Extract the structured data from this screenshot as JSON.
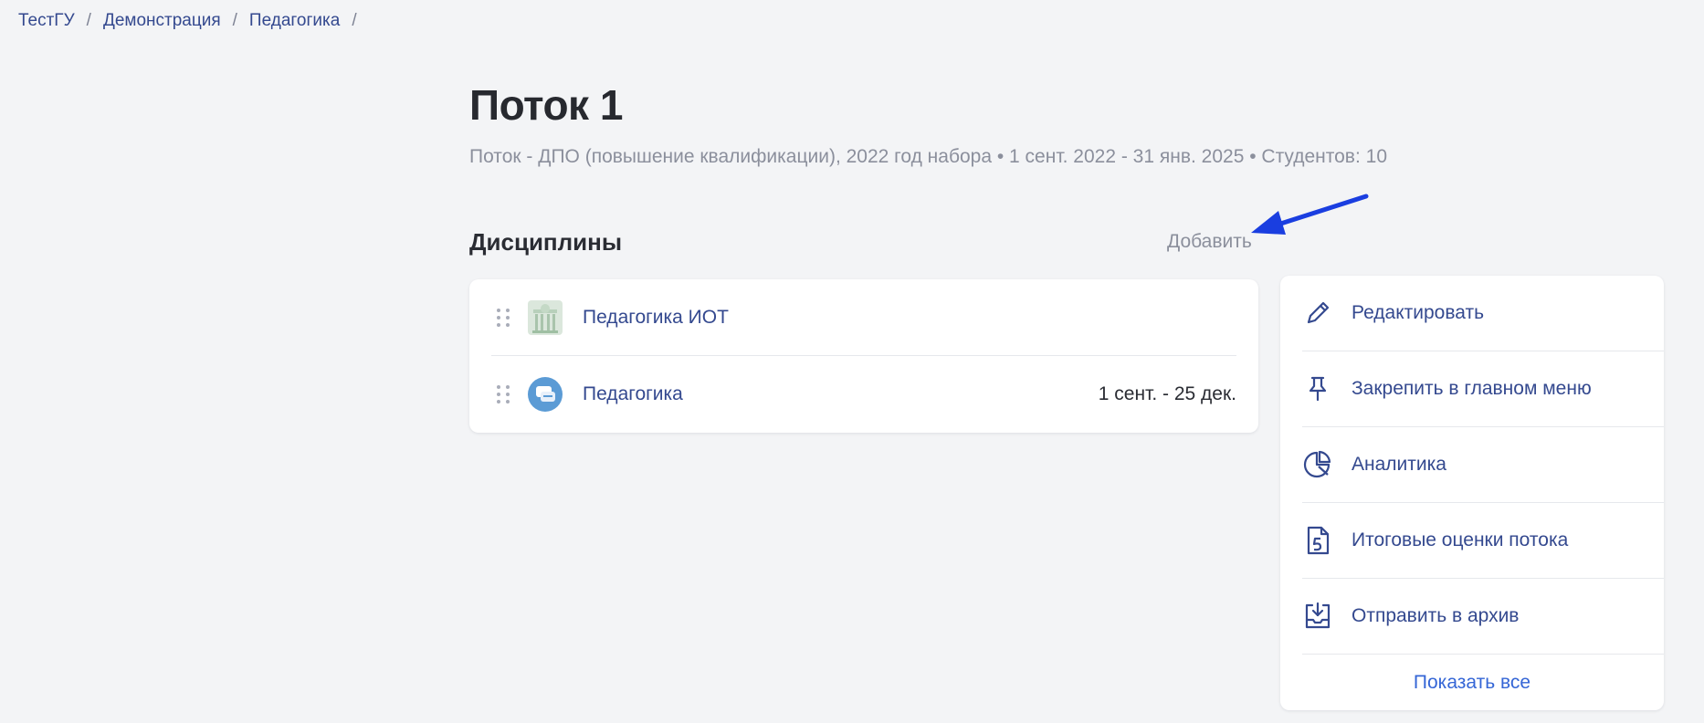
{
  "breadcrumb": {
    "items": [
      "ТестГУ",
      "Демонстрация",
      "Педагогика"
    ],
    "separator": "/"
  },
  "header": {
    "title": "Поток 1",
    "subtitle": "Поток - ДПО (повышение квалификации), 2022 год набора • 1 сент. 2022 - 31 янв. 2025 • Студентов: 10"
  },
  "disciplines": {
    "title": "Дисциплины",
    "add_label": "Добавить",
    "items": [
      {
        "name": "Педагогика ИОТ",
        "dates": "",
        "icon": "building-icon"
      },
      {
        "name": "Педагогика",
        "dates": "1 сент. - 25 дек.",
        "icon": "chat-bubbles-icon"
      }
    ]
  },
  "actions": {
    "items": [
      {
        "label": "Редактировать",
        "icon": "pencil-icon"
      },
      {
        "label": "Закрепить в главном меню",
        "icon": "pin-icon"
      },
      {
        "label": "Аналитика",
        "icon": "pie-chart-icon"
      },
      {
        "label": "Итоговые оценки потока",
        "icon": "grade-document-icon"
      },
      {
        "label": "Отправить в архив",
        "icon": "archive-icon"
      }
    ],
    "show_all_label": "Показать все"
  },
  "colors": {
    "link": "#34498f",
    "accent": "#3566d6",
    "muted": "#8b8f9c",
    "background": "#f3f4f6",
    "annotation_arrow": "#1a3ee0"
  }
}
